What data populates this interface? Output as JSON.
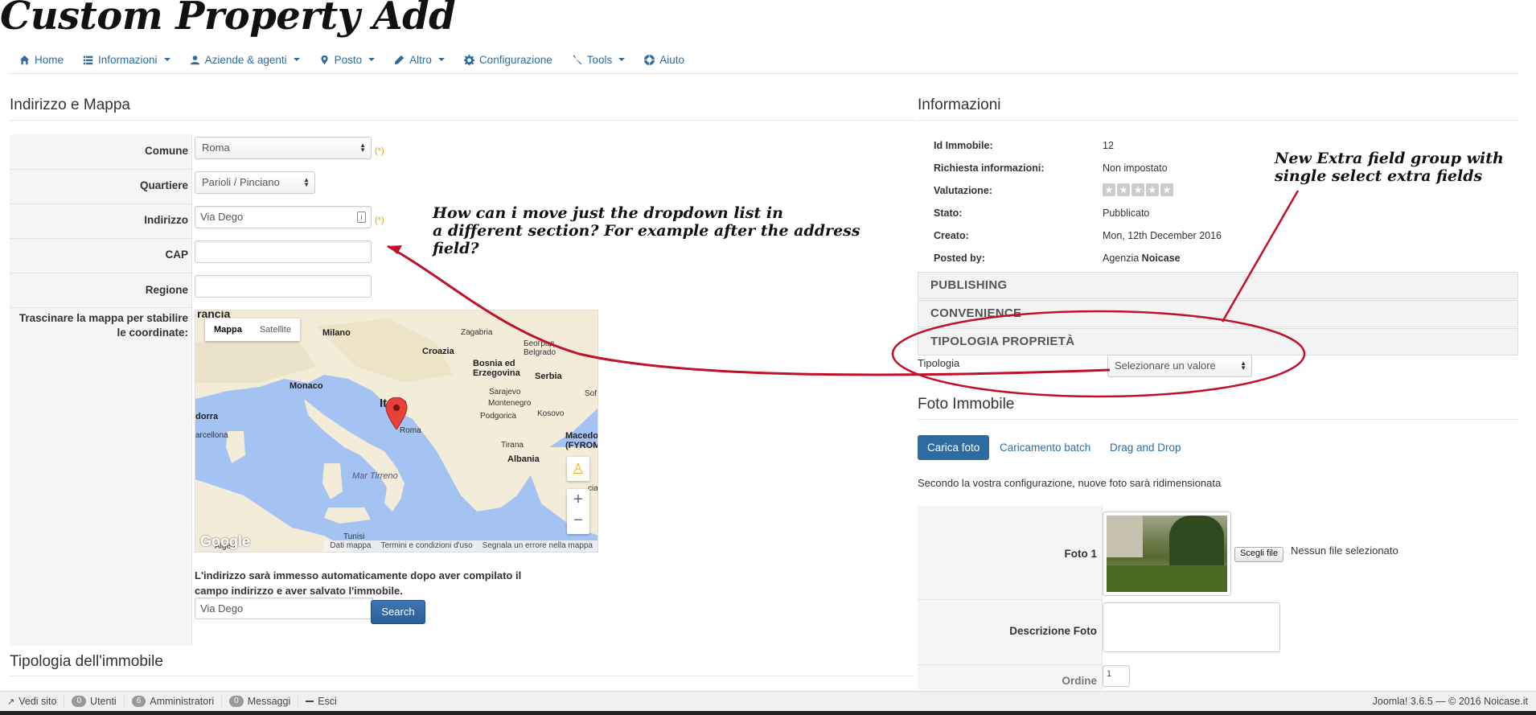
{
  "page": {
    "title": "Custom Property Add"
  },
  "nav": {
    "items": [
      {
        "label": "Home",
        "icon": "home-icon",
        "dropdown": false
      },
      {
        "label": "Informazioni",
        "icon": "list-icon",
        "dropdown": true
      },
      {
        "label": "Aziende & agenti",
        "icon": "user-icon",
        "dropdown": true
      },
      {
        "label": "Posto",
        "icon": "map-marker-icon",
        "dropdown": true
      },
      {
        "label": "Altro",
        "icon": "pencil-icon",
        "dropdown": true
      },
      {
        "label": "Configurazione",
        "icon": "gear-icon",
        "dropdown": false
      },
      {
        "label": "Tools",
        "icon": "wrench-icon",
        "dropdown": true
      },
      {
        "label": "Aiuto",
        "icon": "lifebuoy-icon",
        "dropdown": false
      }
    ]
  },
  "left": {
    "heading": "Indirizzo e Mappa",
    "fields": {
      "comune": {
        "label": "Comune",
        "value": "Roma",
        "required": "(*)"
      },
      "quartiere": {
        "label": "Quartiere",
        "value": "Parioli / Pinciano"
      },
      "indirizzo": {
        "label": "Indirizzo",
        "value": "Via Dego",
        "required": "(*)"
      },
      "cap": {
        "label": "CAP",
        "value": ""
      },
      "regione": {
        "label": "Regione",
        "value": ""
      }
    },
    "map_label": "Trascinare la mappa per stabilire le coordinate:",
    "map": {
      "tab_map": "Mappa",
      "tab_satellite": "Satellite",
      "zoom_in": "+",
      "zoom_out": "−",
      "footer": [
        "Dati mappa",
        "Termini e condizioni d'uso",
        "Segnala un errore nella mappa"
      ],
      "places": {
        "francia": "rancia",
        "milano": "Milano",
        "zagabria": "Zagabria",
        "belgrado": "Београд\nBelgrado",
        "croazia": "Croazia",
        "bosnia": "Bosnia ed\nErzegovina",
        "serbia": "Serbia",
        "monaco": "Monaco",
        "italia": "Italia",
        "sarajevo": "Sarajevo",
        "montenegro": "Montenegro",
        "podgorica": "Podgorica",
        "kosovo": "Kosovo",
        "roma": "Roma",
        "dorra": "dorra",
        "arcellona": "arcellona",
        "macedonia": "Macedonia\n(FYROM)",
        "tirana": "Tirana",
        "albania": "Albania",
        "sea": "Mar Tirreno",
        "tunisi": "Tunisi",
        "algeri": "Algeri",
        "sof": "Sof",
        "cia": "cia",
        "google": "Google"
      }
    },
    "note": "L'indirizzo sarà immesso automaticamente dopo aver compilato il campo indirizzo e aver salvato l'immobile.",
    "search_value": "Via Dego",
    "search_label": "Search",
    "tipologia_heading": "Tipologia dell'immobile"
  },
  "right": {
    "heading": "Informazioni",
    "rows": [
      {
        "key": "Id Immobile:",
        "value": "12"
      },
      {
        "key": "Richiesta informazioni:",
        "value": "Non impostato"
      },
      {
        "key": "Valutazione:",
        "value": ""
      },
      {
        "key": "Stato:",
        "value": "Pubblicato"
      },
      {
        "key": "Creato:",
        "value": "Mon, 12th December 2016"
      },
      {
        "key": "Posted by:",
        "value": "Agenzia",
        "value_bold": "Noicase"
      }
    ],
    "rating": {
      "stars": 5,
      "filled": 0
    },
    "accordions": [
      "PUBLISHING",
      "CONVENIENCE",
      "TIPOLOGIA PROPRIETÀ"
    ],
    "tipologia": {
      "label": "Tipologia",
      "value": "Selezionare un valore"
    },
    "foto_heading": "Foto Immobile",
    "foto_tabs": [
      "Carica foto",
      "Caricamento batch",
      "Drag and Drop"
    ],
    "foto_note": "Secondo la vostra configurazione, nuove foto sarà ridimensionata",
    "foto1_label": "Foto 1",
    "file_button": "Scegli file",
    "file_status": "Nessun file selezionato",
    "descrizione_label": "Descrizione Foto",
    "ordine_label": "Ordine",
    "ordine_value": "1"
  },
  "statusbar": {
    "vedi_sito": "Vedi sito",
    "utenti_count": "0",
    "utenti": "Utenti",
    "admin_count": "6",
    "admin": "Amministratori",
    "messaggi_count": "0",
    "messaggi": "Messaggi",
    "esci": "Esci",
    "right": "Joomla! 3.6.5  —  © 2016 Noicase.it"
  },
  "annotations": {
    "question": "How can i move just the dropdown list in\na different section? For example after the address\nfield?",
    "group": "New Extra field group with\nsingle select extra fields",
    "color": "#c0102a"
  }
}
